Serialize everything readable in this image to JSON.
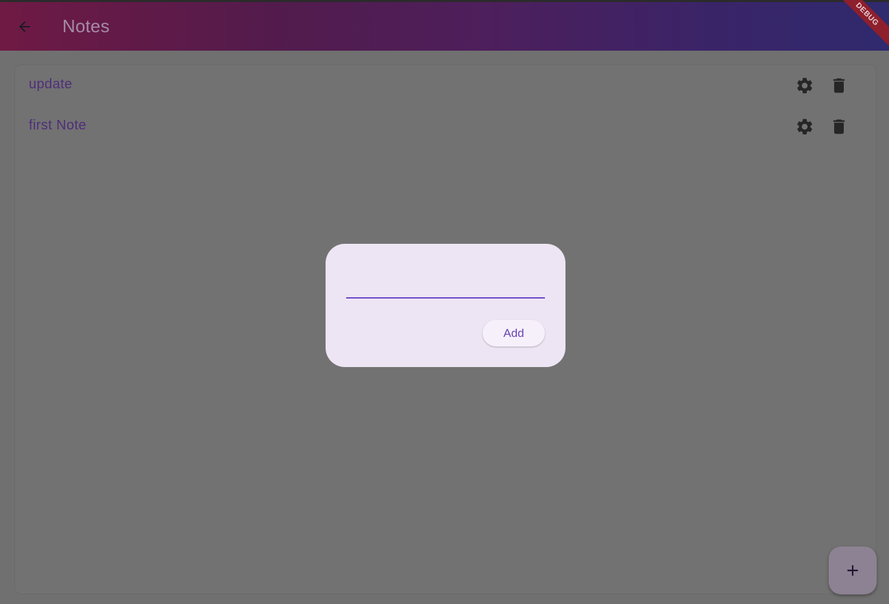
{
  "appbar": {
    "title": "Notes",
    "back_icon": "arrow-left-icon",
    "debug_banner": "DEBUG"
  },
  "notes": [
    {
      "label": "update",
      "settings_icon": "gear-icon",
      "delete_icon": "trash-icon"
    },
    {
      "label": "first Note",
      "settings_icon": "gear-icon",
      "delete_icon": "trash-icon"
    }
  ],
  "dialog": {
    "input_value": "",
    "add_label": "Add"
  },
  "fab": {
    "icon": "plus-icon"
  },
  "colors": {
    "accent": "#6b48c8",
    "note_text": "#4f2e7a",
    "dialog_bg": "#ede5f4",
    "debug_banner": "#8e1f2c"
  }
}
